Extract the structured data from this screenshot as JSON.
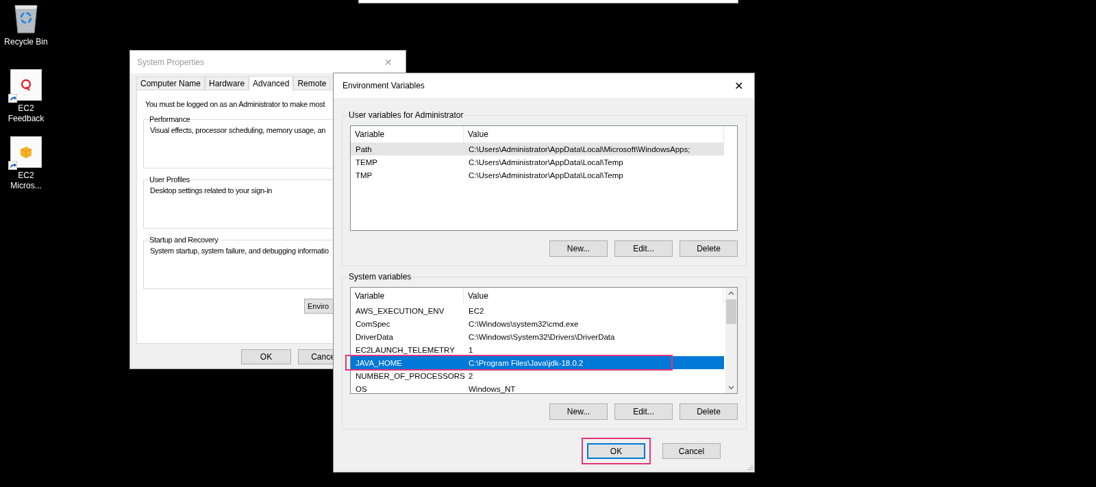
{
  "desktop_icons": [
    {
      "label": "Recycle Bin",
      "kind": "recycle"
    },
    {
      "label": "EC2 Feedback",
      "kind": "feedback",
      "shortcut": true
    },
    {
      "label": "EC2 Micros...",
      "kind": "cube",
      "shortcut": true
    }
  ],
  "system_properties": {
    "title": "System Properties",
    "active": false,
    "tabs": [
      {
        "label": "Computer Name",
        "selected": false
      },
      {
        "label": "Hardware",
        "selected": false
      },
      {
        "label": "Advanced",
        "selected": true
      },
      {
        "label": "Remote",
        "selected": false
      }
    ],
    "notice": "You must be logged on as an Administrator to make most",
    "groups": [
      {
        "title": "Performance",
        "text": "Visual effects, processor scheduling, memory usage, an"
      },
      {
        "title": "User Profiles",
        "text": "Desktop settings related to your sign-in"
      },
      {
        "title": "Startup and Recovery",
        "text": "System startup, system failure, and debugging informatio"
      }
    ],
    "env_button": "Enviro",
    "close": "✕",
    "buttons": [
      "OK",
      "Cance"
    ]
  },
  "environment_variables": {
    "title": "Environment Variables",
    "close": "✕",
    "user_section": {
      "title": "User variables for Administrator",
      "focused": false,
      "columns": [
        "Variable",
        "Value"
      ],
      "rows": [
        {
          "variable": "Path",
          "value": "C:\\Users\\Administrator\\AppData\\Local\\Microsoft\\WindowsApps;",
          "selected": true,
          "highlighted": false
        },
        {
          "variable": "TEMP",
          "value": "C:\\Users\\Administrator\\AppData\\Local\\Temp",
          "selected": false,
          "highlighted": false
        },
        {
          "variable": "TMP",
          "value": "C:\\Users\\Administrator\\AppData\\Local\\Temp",
          "selected": false,
          "highlighted": false
        }
      ],
      "buttons": [
        "New...",
        "Edit...",
        "Delete"
      ]
    },
    "system_section": {
      "title": "System variables",
      "focused": true,
      "columns": [
        "Variable",
        "Value"
      ],
      "rows": [
        {
          "variable": "AWS_EXECUTION_ENV",
          "value": "EC2",
          "selected": false,
          "highlighted": false
        },
        {
          "variable": "ComSpec",
          "value": "C:\\Windows\\system32\\cmd.exe",
          "selected": false,
          "highlighted": false
        },
        {
          "variable": "DriverData",
          "value": "C:\\Windows\\System32\\Drivers\\DriverData",
          "selected": false,
          "highlighted": false
        },
        {
          "variable": "EC2LAUNCH_TELEMETRY",
          "value": "1",
          "selected": false,
          "highlighted": false
        },
        {
          "variable": "JAVA_HOME",
          "value": "C:\\Program Files\\Java\\jdk-18.0.2",
          "selected": true,
          "highlighted": true
        },
        {
          "variable": "NUMBER_OF_PROCESSORS",
          "value": "2",
          "selected": false,
          "highlighted": false
        },
        {
          "variable": "OS",
          "value": "Windows_NT",
          "selected": false,
          "highlighted": false
        }
      ],
      "buttons": [
        "New...",
        "Edit...",
        "Delete"
      ]
    },
    "footer_buttons": [
      {
        "label": "OK",
        "default": true,
        "highlighted": true
      },
      {
        "label": "Cancel",
        "default": false,
        "highlighted": false
      }
    ]
  }
}
